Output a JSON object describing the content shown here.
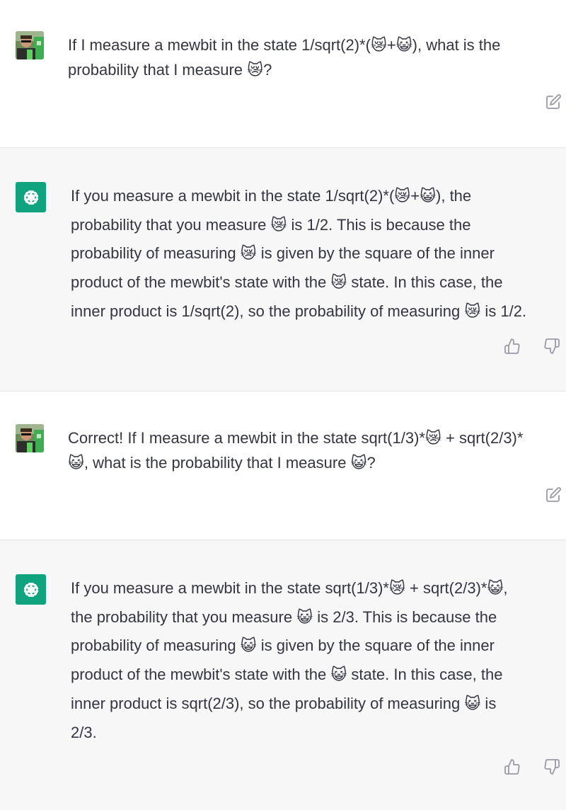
{
  "conversation": [
    {
      "role": "user",
      "avatar": "user-photo",
      "text": "If I measure a mewbit in the state 1/sqrt(2)*(😿+😺), what is the\nprobability that I measure 😿?",
      "actions": [
        "edit-icon"
      ]
    },
    {
      "role": "assistant",
      "avatar": "openai-logo",
      "text": "If you measure a mewbit in the state 1/sqrt(2)*(😿+😺), the\nprobability that you measure 😿 is 1/2. This is because the\nprobability of measuring 😿 is given by the square of the inner\nproduct of the mewbit's state with the 😿 state. In this case, the\ninner product is 1/sqrt(2), so the probability of measuring 😿 is 1/2.",
      "actions": [
        "thumbs-up-icon",
        "thumbs-down-icon"
      ]
    },
    {
      "role": "user",
      "avatar": "user-photo",
      "text": "Correct! If I measure a mewbit in the state sqrt(1/3)*😿 + sqrt(2/3)*\n😺, what is the probability that I measure 😺?",
      "actions": [
        "edit-icon"
      ]
    },
    {
      "role": "assistant",
      "avatar": "openai-logo",
      "text": "If you measure a mewbit in the state sqrt(1/3)*😿 + sqrt(2/3)*😺,\nthe probability that you measure 😺 is 2/3. This is because the\nprobability of measuring 😺 is given by the square of the inner\nproduct of the mewbit's state with the 😺 state. In this case, the\ninner product is sqrt(2/3), so the probability of measuring 😺 is\n2/3.",
      "actions": [
        "thumbs-up-icon",
        "thumbs-down-icon"
      ]
    }
  ],
  "colors": {
    "assistant_accent": "#10a37f",
    "assistant_bg": "#f7f7f8",
    "user_bg": "#ffffff",
    "text": "#343541",
    "icon": "#9a9aa6"
  }
}
